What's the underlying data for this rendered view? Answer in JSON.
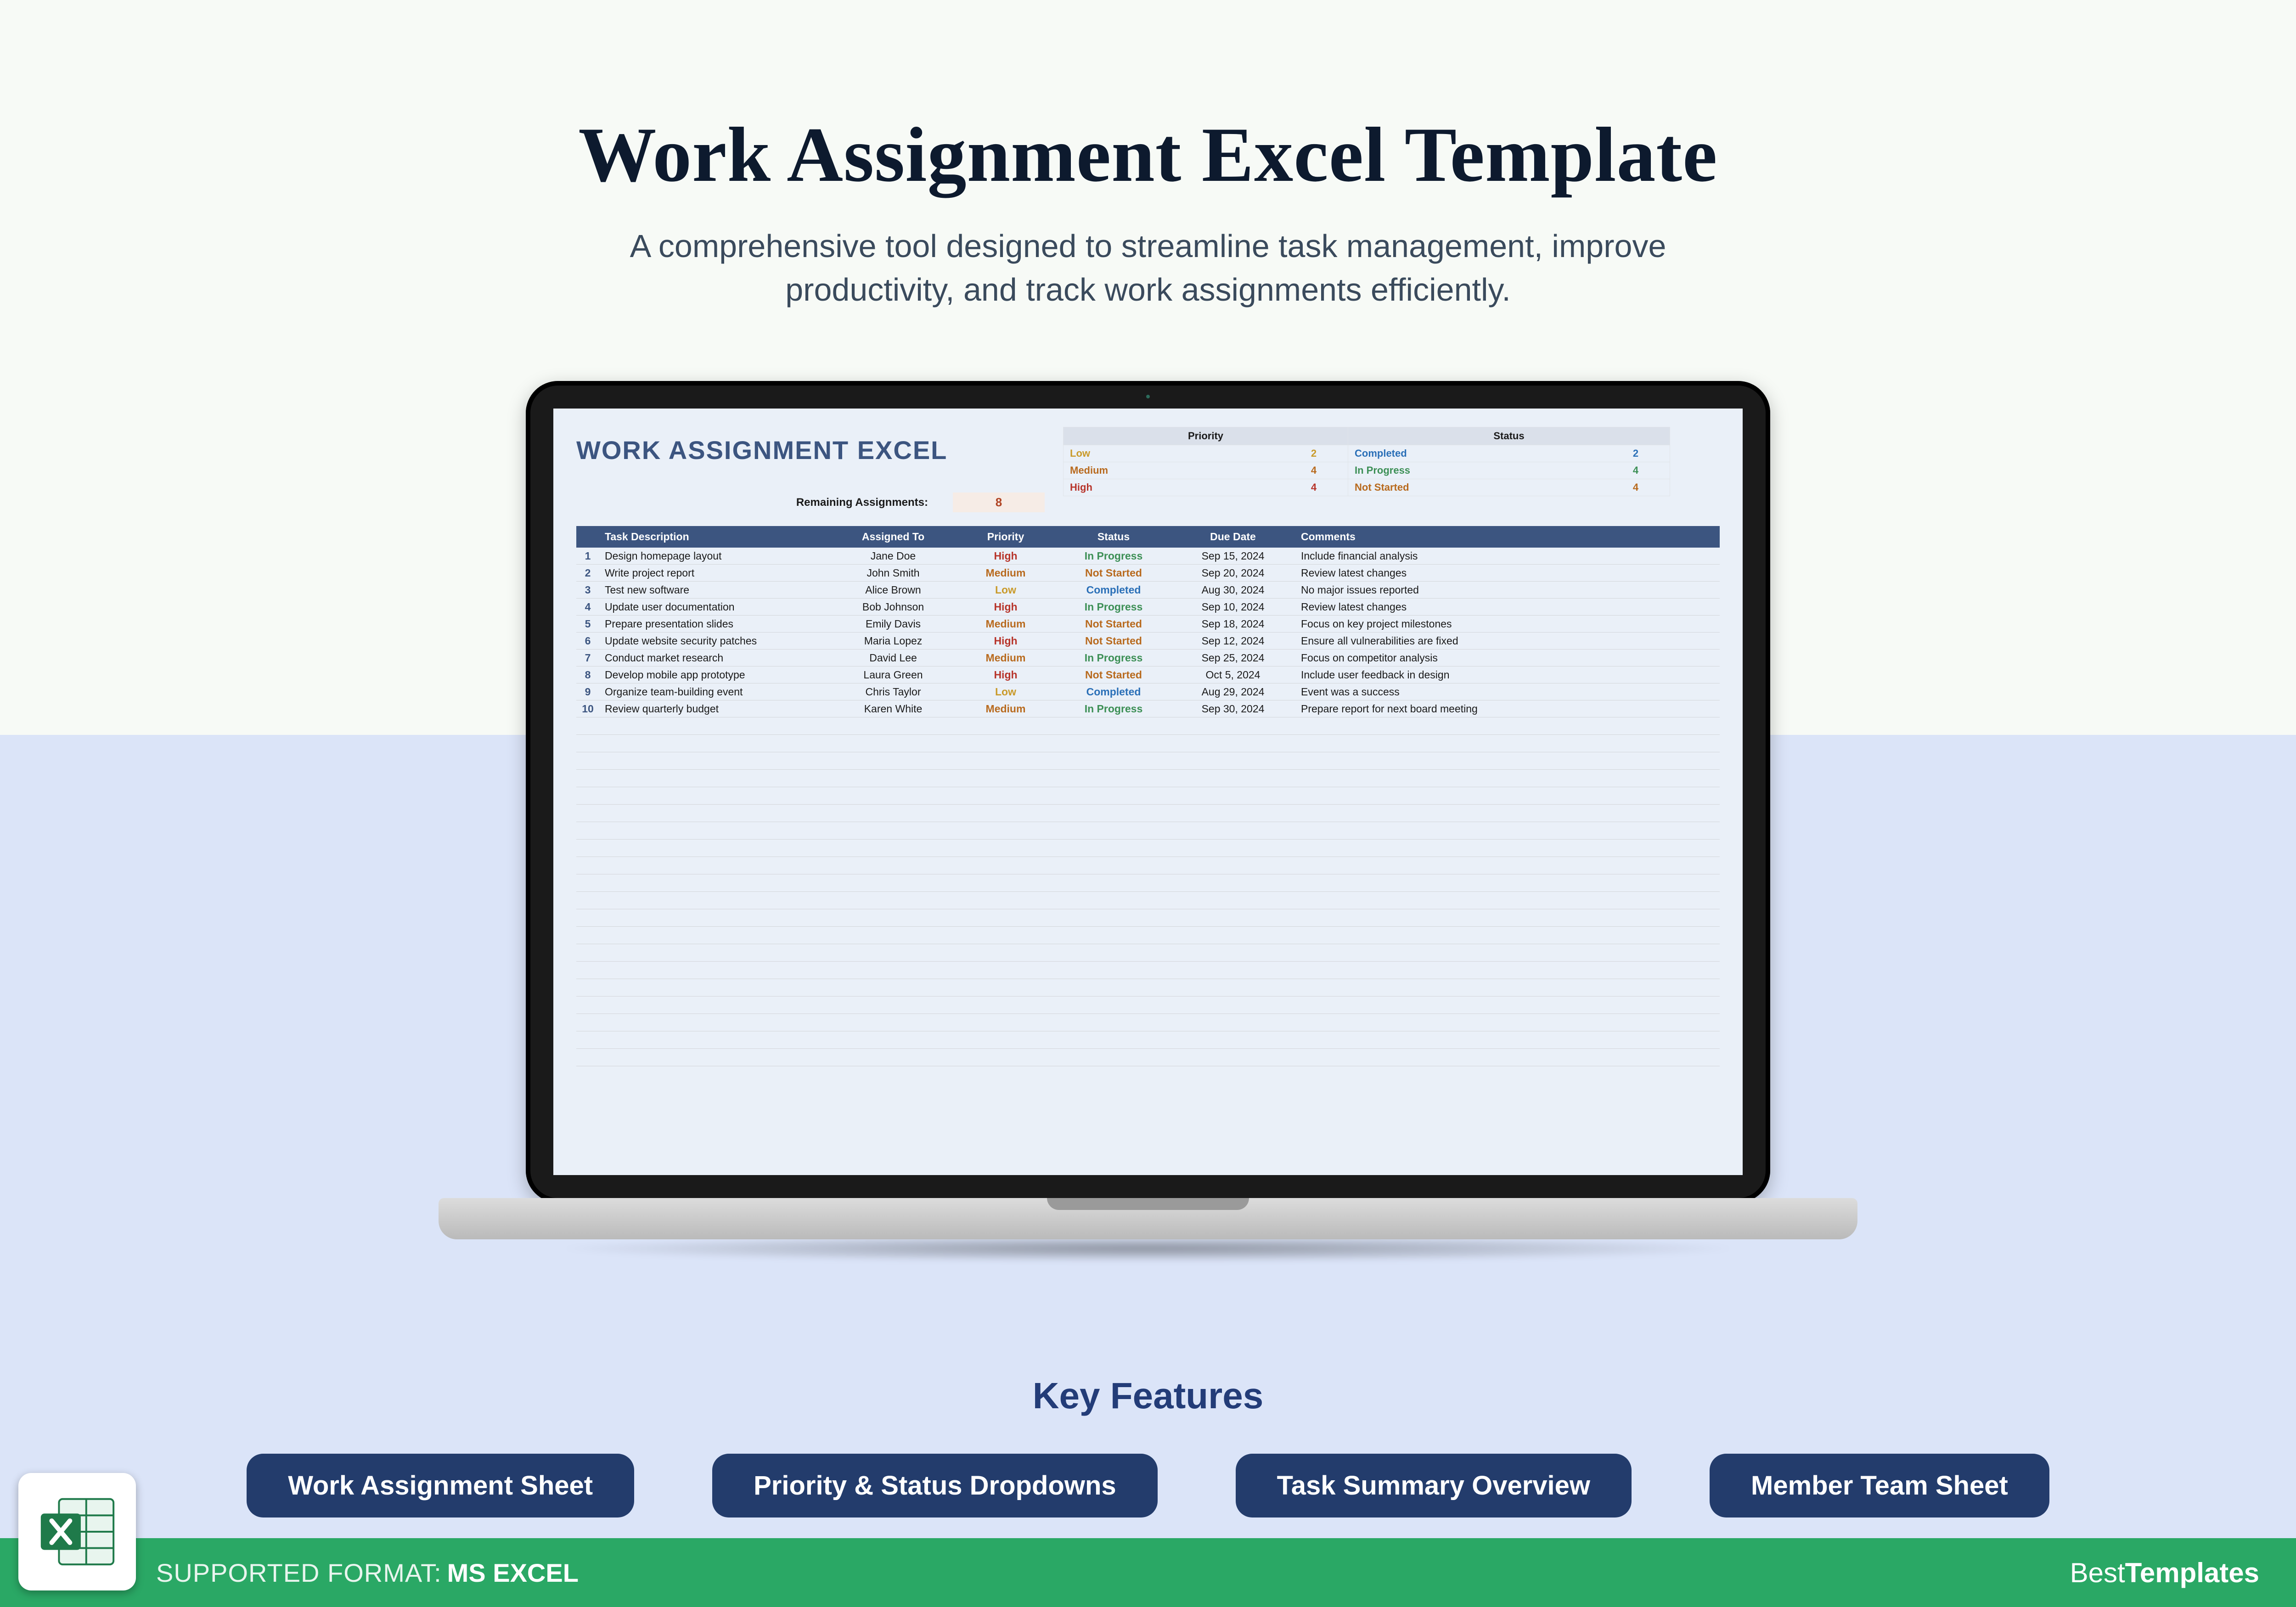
{
  "hero": {
    "title": "Work Assignment Excel Template",
    "subtitle_line1": "A comprehensive tool designed to streamline task management, improve",
    "subtitle_line2": "productivity, and track work assignments efficiently."
  },
  "sheet": {
    "title": "WORK ASSIGNMENT EXCEL",
    "remaining_label": "Remaining Assignments:",
    "remaining_value": "8",
    "priority_header": "Priority",
    "status_header": "Status",
    "priority_summary": [
      {
        "label": "Low",
        "value": "2",
        "class": "c-low"
      },
      {
        "label": "Medium",
        "value": "4",
        "class": "c-med"
      },
      {
        "label": "High",
        "value": "4",
        "class": "c-high"
      }
    ],
    "status_summary": [
      {
        "label": "Completed",
        "value": "2",
        "class": "c-comp"
      },
      {
        "label": "In Progress",
        "value": "4",
        "class": "c-prog"
      },
      {
        "label": "Not Started",
        "value": "4",
        "class": "c-not"
      }
    ],
    "columns": {
      "desc": "Task Description",
      "assigned": "Assigned To",
      "priority": "Priority",
      "status": "Status",
      "due": "Due Date",
      "comments": "Comments"
    },
    "rows": [
      {
        "n": "1",
        "desc": "Design homepage layout",
        "assigned": "Jane Doe",
        "pri": "High",
        "stat": "In Progress",
        "due": "Sep 15, 2024",
        "comm": "Include financial analysis"
      },
      {
        "n": "2",
        "desc": "Write project report",
        "assigned": "John Smith",
        "pri": "Medium",
        "stat": "Not Started",
        "due": "Sep 20, 2024",
        "comm": "Review latest changes"
      },
      {
        "n": "3",
        "desc": "Test new software",
        "assigned": "Alice Brown",
        "pri": "Low",
        "stat": "Completed",
        "due": "Aug 30, 2024",
        "comm": "No major issues reported"
      },
      {
        "n": "4",
        "desc": "Update user documentation",
        "assigned": "Bob Johnson",
        "pri": "High",
        "stat": "In Progress",
        "due": "Sep 10, 2024",
        "comm": "Review latest changes"
      },
      {
        "n": "5",
        "desc": "Prepare presentation slides",
        "assigned": "Emily Davis",
        "pri": "Medium",
        "stat": "Not Started",
        "due": "Sep 18, 2024",
        "comm": "Focus on key project milestones"
      },
      {
        "n": "6",
        "desc": "Update website security patches",
        "assigned": "Maria Lopez",
        "pri": "High",
        "stat": "Not Started",
        "due": "Sep 12, 2024",
        "comm": "Ensure all vulnerabilities are fixed"
      },
      {
        "n": "7",
        "desc": "Conduct market research",
        "assigned": "David Lee",
        "pri": "Medium",
        "stat": "In Progress",
        "due": "Sep 25, 2024",
        "comm": "Focus on competitor analysis"
      },
      {
        "n": "8",
        "desc": "Develop mobile app prototype",
        "assigned": "Laura Green",
        "pri": "High",
        "stat": "Not Started",
        "due": "Oct 5, 2024",
        "comm": "Include user feedback in design"
      },
      {
        "n": "9",
        "desc": "Organize team-building event",
        "assigned": "Chris Taylor",
        "pri": "Low",
        "stat": "Completed",
        "due": "Aug 29, 2024",
        "comm": "Event was a success"
      },
      {
        "n": "10",
        "desc": "Review quarterly budget",
        "assigned": "Karen White",
        "pri": "Medium",
        "stat": "In Progress",
        "due": "Sep 30, 2024",
        "comm": "Prepare report for next board meeting"
      }
    ]
  },
  "features": {
    "title": "Key Features",
    "pills": [
      "Work Assignment Sheet",
      "Priority & Status Dropdowns",
      "Task Summary Overview",
      "Member Team Sheet"
    ]
  },
  "footer": {
    "supported_label": "SUPPORTED FORMAT:",
    "format": "MS EXCEL",
    "brand_regular": "Best",
    "brand_bold": "Templates"
  }
}
